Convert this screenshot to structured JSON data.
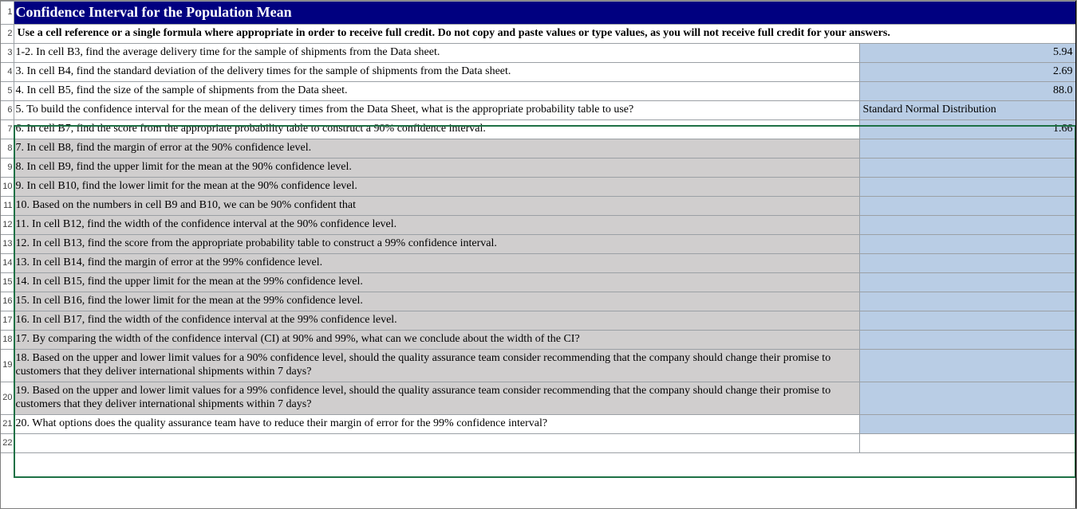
{
  "title": "Confidence Interval for the Population Mean",
  "instructions": "Use a cell reference or a single formula where appropriate in order to receive full credit. Do not copy and paste values or type values, as you will not receive full credit for your answers.",
  "rows": [
    {
      "num": "3",
      "q": "1-2. In cell B3, find the average delivery time for the sample of shipments from the Data sheet.",
      "ans": "5.94",
      "ansAlign": "num",
      "grey": false
    },
    {
      "num": "4",
      "q": "3. In cell B4, find the standard deviation of the delivery times for the sample of shipments from the Data sheet.",
      "ans": "2.69",
      "ansAlign": "num",
      "grey": false
    },
    {
      "num": "5",
      "q": "4. In cell B5, find the size of the sample of shipments from the Data sheet.",
      "ans": "88.0",
      "ansAlign": "num",
      "grey": false
    },
    {
      "num": "6",
      "q": "5. To build the confidence interval for the mean of the delivery times from the Data Sheet, what is the appropriate probability table to use?",
      "ans": "Standard Normal Distribution",
      "ansAlign": "left",
      "grey": false
    },
    {
      "num": "7",
      "q": "6. In cell B7, find the score from the appropriate probability table to construct a 90% confidence interval.",
      "ans": "1.66",
      "ansAlign": "num",
      "grey": false
    },
    {
      "num": "8",
      "q": "7. In cell B8, find the margin of error at the 90% confidence level.",
      "ans": "",
      "ansAlign": "num",
      "grey": true
    },
    {
      "num": "9",
      "q": "8. In cell B9, find the upper limit for the mean at the 90% confidence level.",
      "ans": "",
      "ansAlign": "num",
      "grey": true
    },
    {
      "num": "10",
      "q": "9. In cell B10, find the lower limit for the mean at the 90% confidence level.",
      "ans": "",
      "ansAlign": "num",
      "grey": true
    },
    {
      "num": "11",
      "q": "10. Based on the numbers in cell B9 and B10, we can be 90% confident that",
      "ans": "",
      "ansAlign": "left",
      "grey": true
    },
    {
      "num": "12",
      "q": "11. In cell B12, find the width of the confidence interval at the 90% confidence level.",
      "ans": "",
      "ansAlign": "num",
      "grey": true
    },
    {
      "num": "13",
      "q": "12. In cell B13, find the score from the appropriate probability table to construct a 99% confidence interval.",
      "ans": "",
      "ansAlign": "num",
      "grey": true
    },
    {
      "num": "14",
      "q": "13. In cell B14, find the margin of error at the 99% confidence level.",
      "ans": "",
      "ansAlign": "num",
      "grey": true
    },
    {
      "num": "15",
      "q": "14. In cell B15, find the upper limit for the mean at the 99% confidence level.",
      "ans": "",
      "ansAlign": "num",
      "grey": true
    },
    {
      "num": "16",
      "q": "15. In cell B16, find the lower limit for the mean at the 99% confidence level.",
      "ans": "",
      "ansAlign": "num",
      "grey": true
    },
    {
      "num": "17",
      "q": "16. In cell B17, find the width of the confidence interval at the 99% confidence level.",
      "ans": "",
      "ansAlign": "num",
      "grey": true
    },
    {
      "num": "18",
      "q": "17. By comparing the width of the confidence interval (CI) at 90% and 99%, what can we conclude about the width of the CI?",
      "ans": "",
      "ansAlign": "left",
      "grey": true
    },
    {
      "num": "19",
      "q": "18. Based on the upper and lower limit values for a 90% confidence level, should the quality assurance team consider recommending that the company should change their promise to customers that they deliver international shipments within 7 days?",
      "ans": "",
      "ansAlign": "left",
      "grey": true,
      "tall": true
    },
    {
      "num": "20",
      "q": "19. Based on the upper and lower limit values for a 99% confidence level, should the quality assurance team consider recommending that the company should change their promise to customers that they deliver international shipments within 7 days?",
      "ans": "",
      "ansAlign": "left",
      "grey": true,
      "tall": true
    },
    {
      "num": "21",
      "q": "20. What options does the quality assurance team have to reduce their margin of error for the 99% confidence interval?",
      "ans": "",
      "ansAlign": "left",
      "grey": false
    }
  ],
  "trailing_row_num": "22"
}
